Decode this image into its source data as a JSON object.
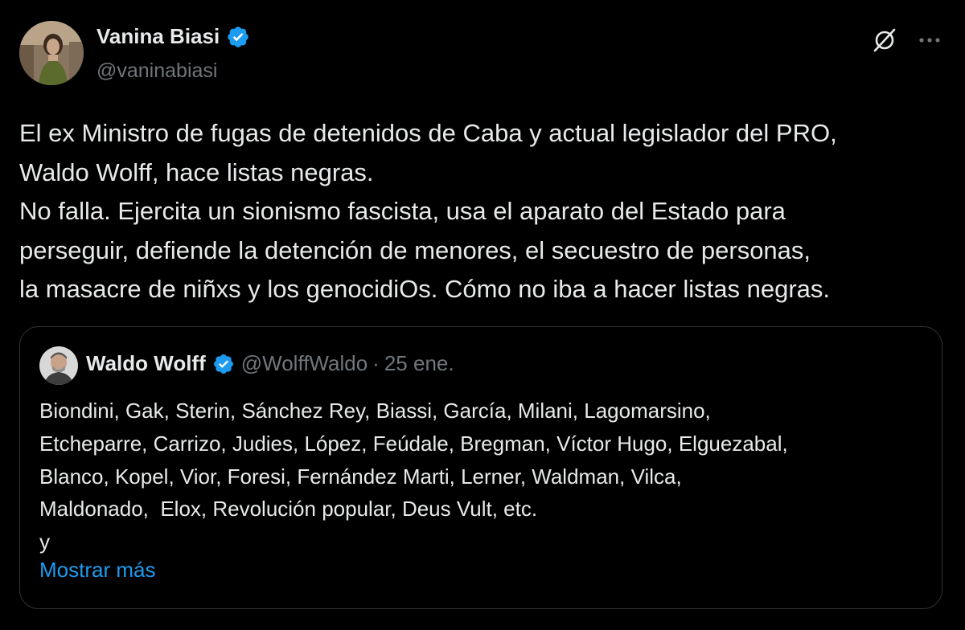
{
  "author": {
    "display_name": "Vanina Biasi",
    "handle": "@vaninabiasi",
    "verified": true
  },
  "icons": {
    "grok": "grok-icon",
    "more": "more-horizontal-icon",
    "verified": "verified-badge-icon"
  },
  "colors": {
    "background": "#000000",
    "text": "#e7e9ea",
    "muted": "#71767b",
    "accent": "#1d9bf0",
    "border": "#2f3336"
  },
  "tweet": {
    "lines": [
      "El ex Ministro de fugas de detenidos de Caba y actual legislador del PRO,",
      "Waldo Wolff, hace listas negras.",
      "No falla. Ejercita un sionismo fascista, usa el aparato del Estado para",
      "perseguir, defiende la detención de menores, el secuestro de personas,",
      "la masacre de niñxs y los genocidiOs. Cómo no iba a hacer listas negras."
    ]
  },
  "quote": {
    "display_name": "Waldo Wolff",
    "handle": "@WolffWaldo",
    "separator": "·",
    "date": "25 ene.",
    "verified": true,
    "lines": [
      "Biondini, Gak, Sterin, Sánchez Rey, Biassi, García, Milani, Lagomarsino,",
      "Etcheparre, Carrizo, Judies, López, Feúdale, Bregman, Víctor Hugo, Elguezabal,",
      "Blanco, Kopel, Vior, Foresi, Fernández Marti, Lerner, Waldman, Vilca,",
      "Maldonado,  Elox, Revolución popular, Deus Vult, etc.",
      "y"
    ],
    "show_more_label": "Mostrar más"
  }
}
